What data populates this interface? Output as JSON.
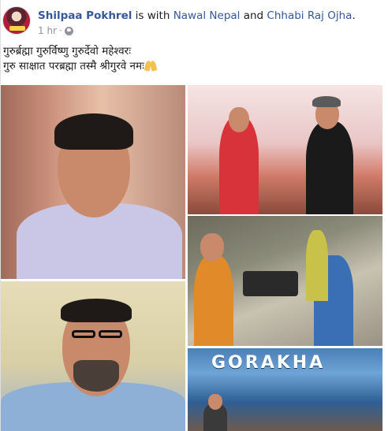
{
  "post": {
    "author": "Shilpaa Pokhrel",
    "with_text": " is with ",
    "friend1": "Nawal Nepal",
    "and_text": " and ",
    "friend2": "Chhabi Raj Ojha",
    "period": ".",
    "time": "1 hr",
    "separator": "·",
    "privacy_icon": "globe-icon",
    "line1": "गुरुर्ब्रह्मा गुरुर्विष्णु गुरुर्देवो महेश्वरः",
    "line2": "गुरु साक्षात परब्रह्मा तस्मै श्रीगुरवे नमः",
    "emoji": "folded-hands-emoji"
  },
  "gallery": {
    "sign_text": "GORAKHA"
  },
  "colors": {
    "link": "#365899",
    "meta": "#90949c",
    "text": "#1c1e21"
  }
}
